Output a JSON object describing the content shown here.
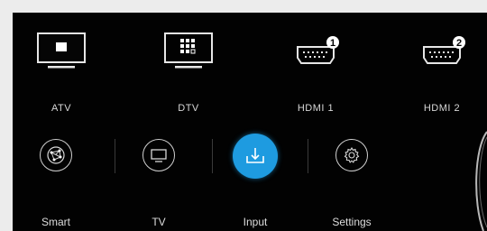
{
  "sources": [
    {
      "label": "ATV",
      "icon": "tv-monitor-icon"
    },
    {
      "label": "DTV",
      "icon": "tv-grid-icon"
    },
    {
      "label": "HDMI 1",
      "icon": "hdmi-port-icon",
      "badge": "1"
    },
    {
      "label": "HDMI 2",
      "icon": "hdmi-port-icon",
      "badge": "2"
    }
  ],
  "menu": [
    {
      "label": "Smart",
      "icon": "smart-network-icon"
    },
    {
      "label": "TV",
      "icon": "tv-icon"
    },
    {
      "label": "Input",
      "icon": "input-arrow-icon",
      "selected": true
    },
    {
      "label": "Settings",
      "icon": "gear-icon"
    }
  ],
  "colors": {
    "accent": "#1e9be0",
    "background": "#020202"
  }
}
